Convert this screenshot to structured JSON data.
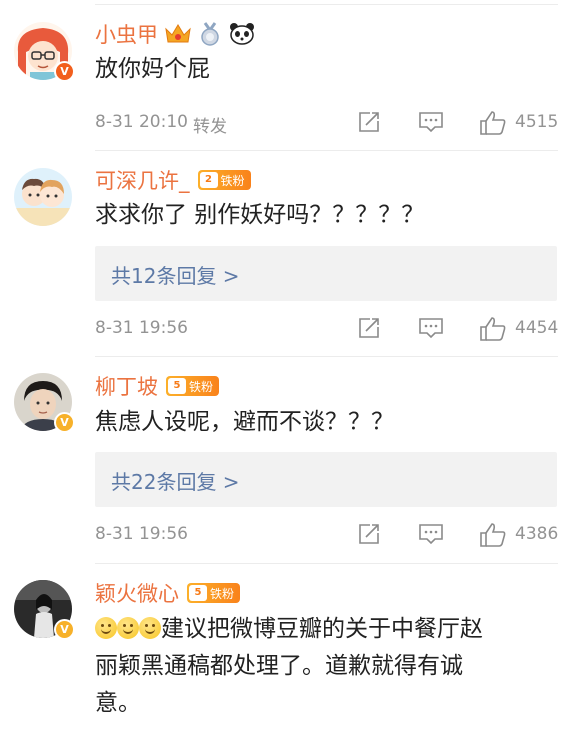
{
  "comments": [
    {
      "username": "小虫甲",
      "text": "放你妈个屁",
      "time": "8-31 20:10",
      "repost_label": "转发",
      "likes": "4515",
      "avatar_badge": "V",
      "badges": [
        "crown-icon",
        "medal-icon",
        "panda-icon"
      ]
    },
    {
      "username": "可深几许_",
      "fan_level": "2",
      "fan_label": "铁粉",
      "text": "求求你了  别作妖好吗？？？？？",
      "reply_label": "共12条回复 >",
      "time": "8-31 19:56",
      "likes": "4454"
    },
    {
      "username": "柳丁坡",
      "fan_level": "5",
      "fan_label": "铁粉",
      "text": "焦虑人设呢，避而不谈？？？",
      "reply_label": "共22条回复 >",
      "time": "8-31 19:56",
      "likes": "4386",
      "avatar_badge": "V"
    },
    {
      "username": "颖火微心",
      "fan_level": "5",
      "fan_label": "铁粉",
      "text_line1": "建议把微博豆瓣的关于中餐厅赵",
      "text_line2": "丽颖黑通稿都处理了。道歉就得有诚",
      "text_line3": "意。",
      "avatar_badge": "V",
      "emojis": [
        "smile-emoji",
        "smile-emoji",
        "smile-emoji"
      ]
    }
  ],
  "colors": {
    "username": "#eb7340",
    "meta": "#939393",
    "reply_link": "#5d79a6",
    "fan_badge": "#fcb02a"
  }
}
